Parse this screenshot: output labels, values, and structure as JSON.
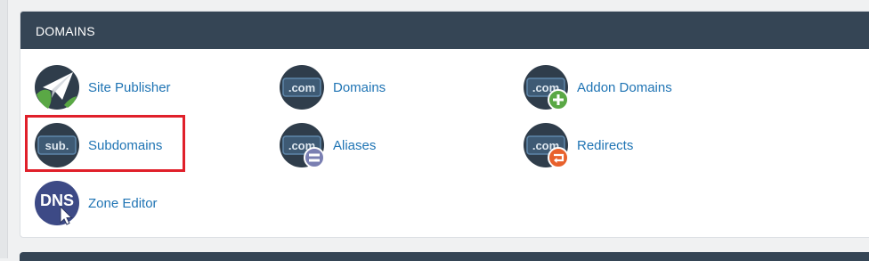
{
  "section": {
    "title": "DOMAINS"
  },
  "items": [
    {
      "label": "Site Publisher",
      "icon": "site-publisher-icon"
    },
    {
      "label": "Domains",
      "icon": "domains-icon",
      "icon_text": ".com"
    },
    {
      "label": "Addon Domains",
      "icon": "addon-domains-icon",
      "icon_text": ".com"
    },
    {
      "label": "Subdomains",
      "icon": "subdomains-icon",
      "icon_text": "sub.",
      "highlighted": true
    },
    {
      "label": "Aliases",
      "icon": "aliases-icon",
      "icon_text": ".com"
    },
    {
      "label": "Redirects",
      "icon": "redirects-icon",
      "icon_text": ".com"
    },
    {
      "label": "Zone Editor",
      "icon": "zone-editor-icon",
      "icon_text": "DNS"
    }
  ],
  "colors": {
    "header_bg": "#354555",
    "link": "#1f74b4",
    "highlight": "#e0202a",
    "badge_green": "#5aa845",
    "badge_purple": "#7a7fb2",
    "badge_orange": "#e8612c"
  }
}
